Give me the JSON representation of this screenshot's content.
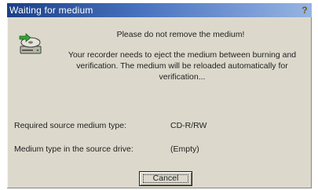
{
  "window": {
    "title": "Waiting for medium",
    "help_glyph": "?"
  },
  "message": {
    "heading": "Please do not remove the medium!",
    "body": "Your recorder needs to eject the medium between burning and verification. The medium will be reloaded automatically for verification..."
  },
  "details": {
    "required_label": "Required source medium type:",
    "required_value": "CD-R/RW",
    "current_label": "Medium type in the source drive:",
    "current_value": "(Empty)"
  },
  "buttons": {
    "cancel_label": "Cancel"
  },
  "icons": {
    "dialog_icon": "disc-drive-eject-icon",
    "help_icon": "help-icon"
  },
  "colors": {
    "titlebar_start": "#1a3f86",
    "titlebar_end": "#97b4e2",
    "dialog_face": "#dcd9cc"
  }
}
